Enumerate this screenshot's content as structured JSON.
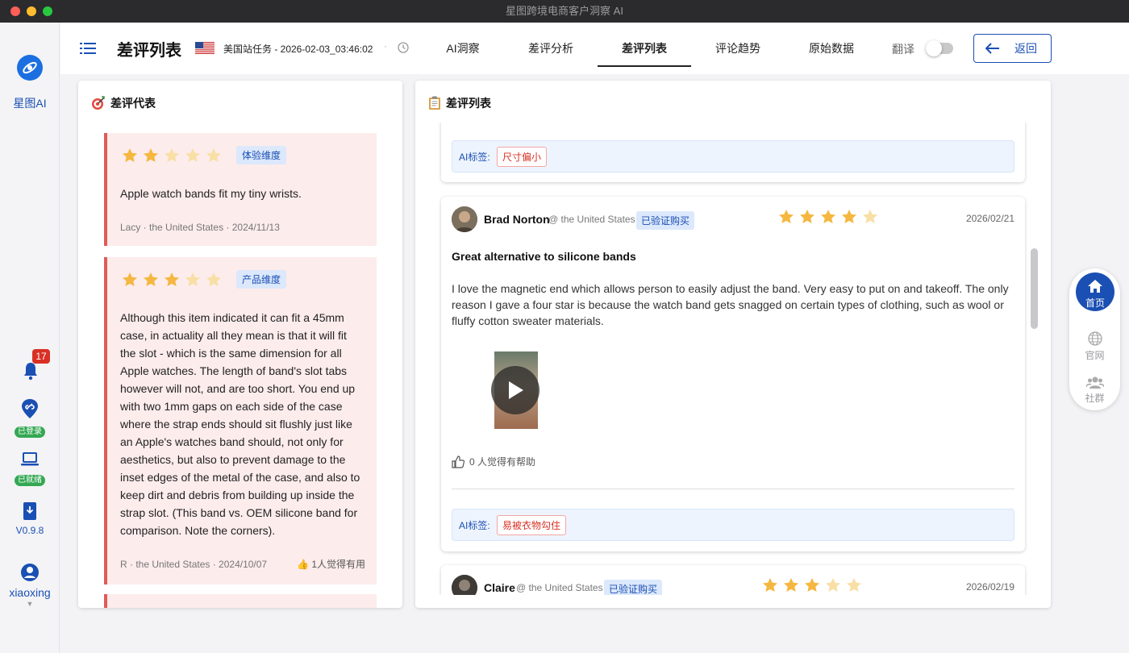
{
  "window": {
    "title": "星图跨境电商客户洞察 AI"
  },
  "sidebar": {
    "logo_label": "星图AI",
    "notification_count": "17",
    "login_status": "已登录",
    "device_status": "已就绪",
    "version": "V0.9.8",
    "username": "xiaoxing"
  },
  "header": {
    "page_title": "差评列表",
    "task": "美国站任务 - 2026-02-03_03:46:02",
    "separator": "·",
    "tabs": [
      {
        "label": "AI洞察",
        "active": false
      },
      {
        "label": "差评分析",
        "active": false
      },
      {
        "label": "差评列表",
        "active": true
      },
      {
        "label": "评论趋势",
        "active": false
      },
      {
        "label": "原始数据",
        "active": false
      }
    ],
    "translate_label": "翻译",
    "translate_on": false,
    "back_label": "返回"
  },
  "left_panel": {
    "title": "差评代表",
    "cards": [
      {
        "rating": 2,
        "dimension": "体验维度",
        "text": "Apple watch bands fit my tiny wrists.",
        "meta": "Lacy · the United States · 2024/11/13",
        "helpful": ""
      },
      {
        "rating": 3,
        "dimension": "产品维度",
        "text": "Although this item indicated it can fit a 45mm case, in actuality all they mean is that it will fit the slot - which is the same dimension for all Apple watches. The length of band's slot tabs however will not, and are too short. You end up with two 1mm gaps on each side of the case where the strap ends should sit flushly just like an Apple's watches band should, not only for aesthetics, but also to prevent damage to the inset edges of the metal of the case, and also to keep dirt and debris from building up inside the strap slot. (This band vs. OEM silicone band for comparison. Note the corners).",
        "meta": "R · the United States · 2024/10/07",
        "helpful": "1人觉得有用"
      }
    ]
  },
  "right_panel": {
    "title": "差评列表",
    "ai_label": "AI标签:",
    "top_card": {
      "ai_tag": "尺寸偏小"
    },
    "reviews": [
      {
        "name": "Brad Norton",
        "location": "@ the United States",
        "verified": "已验证购买",
        "rating": 4,
        "date": "2026/02/21",
        "title": "Great alternative to silicone bands",
        "body": "I love the magnetic end which allows person to easily adjust the band. Very easy to put on and takeoff. The only reason I gave a four star is because the watch band gets snagged on certain types of clothing, such as wool or fluffy cotton sweater materials.",
        "helpful": "0 人觉得有帮助",
        "ai_tag": "易被衣物勾住"
      },
      {
        "name": "Claire",
        "location": "@ the United States",
        "verified": "已验证购买",
        "rating": 3,
        "date": "2026/02/19"
      }
    ]
  },
  "float_nav": {
    "home": "首页",
    "site": "官网",
    "community": "社群"
  },
  "colors": {
    "accent": "#1a4fb3",
    "danger": "#d93025",
    "star": "#f5b740",
    "star_empty": "#f8dfa6"
  }
}
